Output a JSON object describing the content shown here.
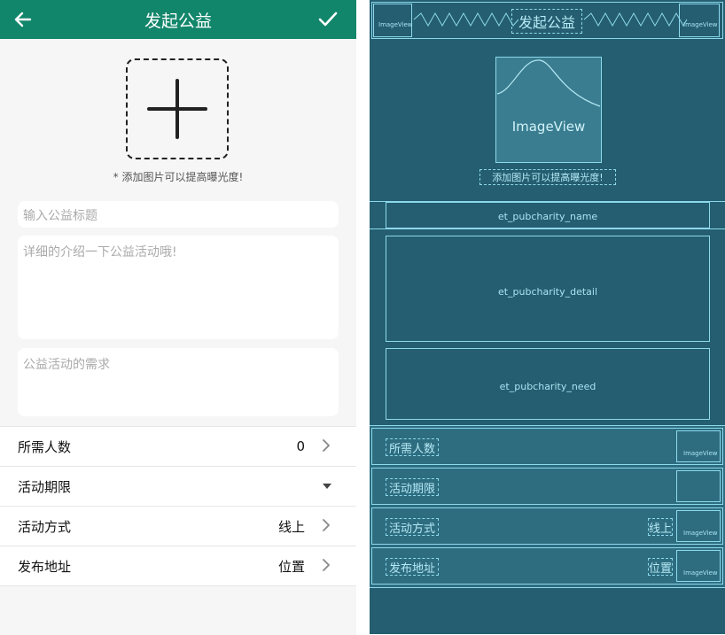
{
  "appbar": {
    "title": "发起公益",
    "back_icon": "arrow-left-icon",
    "confirm_icon": "check-icon",
    "color": "#12866b"
  },
  "photo": {
    "add_icon": "plus-icon",
    "hint": "* 添加图片可以提高曝光度!"
  },
  "form": {
    "title_placeholder": "输入公益标题",
    "detail_placeholder": "详细的介绍一下公益活动哦!",
    "need_placeholder": "公益活动的需求"
  },
  "rows": [
    {
      "label": "所需人数",
      "value": "0",
      "indicator": "chevron-right-icon"
    },
    {
      "label": "活动期限",
      "value": "",
      "indicator": "dropdown-triangle-icon"
    },
    {
      "label": "活动方式",
      "value": "线上",
      "indicator": "chevron-right-icon"
    },
    {
      "label": "发布地址",
      "value": "位置",
      "indicator": "chevron-right-icon"
    }
  ],
  "blueprint": {
    "title": "发起公益",
    "imageview_label": "ImageView",
    "hint": "添加图片可以提高曝光度!",
    "name_field": "et_pubcharity_name",
    "detail_field": "et_pubcharity_detail",
    "need_field": "et_pubcharity_need",
    "row_labels": [
      "所需人数",
      "活动期限",
      "活动方式",
      "发布地址"
    ],
    "row_values": [
      "线上",
      "位置"
    ],
    "small_image_label": "ImageView",
    "background": "#245e70",
    "stroke": "#8dd9ec"
  }
}
